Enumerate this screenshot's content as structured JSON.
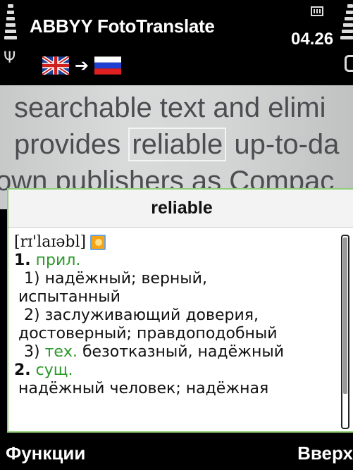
{
  "status_bar": {
    "app_title": "ABBYY FotoTranslate",
    "time": "04.26",
    "source_language_flag": "uk-flag",
    "target_language_flag": "ru-flag",
    "direction_icon": "arrow-right"
  },
  "photo_text": {
    "line1": "searchable text and elimi",
    "line2_before": "provides ",
    "line2_highlight": "reliable",
    "line2_after": " up-to-da",
    "line3": "own publishers as Compac"
  },
  "dictionary": {
    "headword": "reliable",
    "transcription": "[rɪ'laɪəbl]",
    "entries": [
      {
        "num": "1.",
        "pos": "прил."
      },
      {
        "sense": "1) надёжный; верный,",
        "cont": "испытанный"
      },
      {
        "sense": "2) заслуживающий доверия,",
        "cont": "достоверный; правдоподобный"
      },
      {
        "sense_num": "3) ",
        "label": "тех.",
        "sense_text": " безотказный, надёжный"
      },
      {
        "num": "2.",
        "pos": "сущ."
      },
      {
        "text": "надёжный человек; надёжная"
      }
    ]
  },
  "softkeys": {
    "left": "Функции",
    "right": "Вверх"
  },
  "colors": {
    "accent_green": "#2a9a2a",
    "popup_border": "#8fcf79"
  }
}
